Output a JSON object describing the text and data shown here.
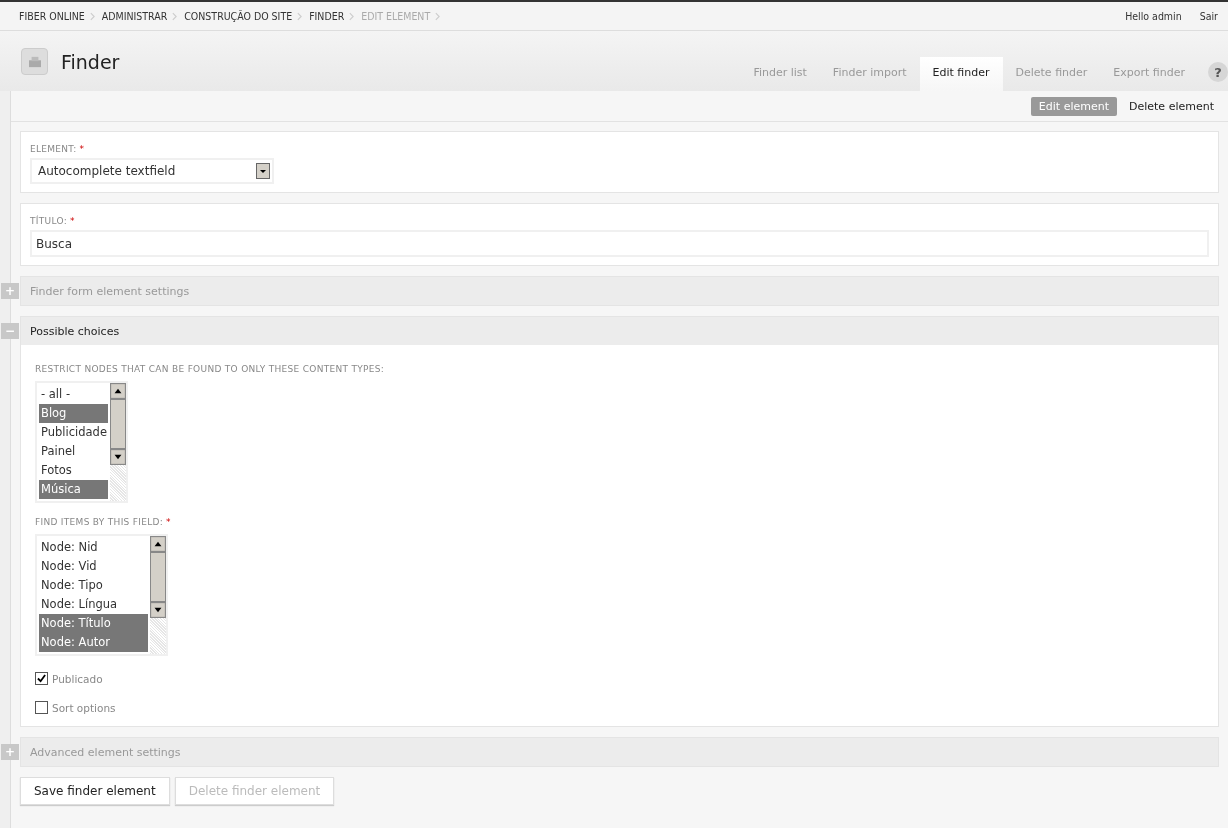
{
  "breadcrumb": [
    {
      "label": "FIBER ONLINE",
      "current": false
    },
    {
      "label": "ADMINISTRAR",
      "current": false
    },
    {
      "label": "CONSTRUÇÃO DO SITE",
      "current": false
    },
    {
      "label": "FINDER",
      "current": false
    },
    {
      "label": "EDIT ELEMENT",
      "current": true
    }
  ],
  "user_links": [
    "Hello admin",
    "Sair"
  ],
  "page_title": "Finder",
  "tabs": [
    {
      "label": "Finder list",
      "selected": false
    },
    {
      "label": "Finder import",
      "selected": false
    },
    {
      "label": "Edit finder",
      "selected": true
    },
    {
      "label": "Delete finder",
      "selected": false
    },
    {
      "label": "Export finder",
      "selected": false
    }
  ],
  "help": "?",
  "subtabs": [
    {
      "label": "Edit element",
      "selected": true
    },
    {
      "label": "Delete element",
      "selected": false
    }
  ],
  "element_field": {
    "label": "ELEMENT:",
    "required_mark": "*",
    "value": "Autocomplete textfield"
  },
  "title_field": {
    "label": "TÍTULO:",
    "required_mark": "*",
    "value": "Busca"
  },
  "fieldsets": [
    {
      "title": "Finder form element settings",
      "expanded": false,
      "toggle": "+"
    },
    {
      "title": "Possible choices",
      "expanded": true,
      "toggle": "−"
    }
  ],
  "content_types": {
    "label": "RESTRICT NODES THAT CAN BE FOUND TO ONLY THESE CONTENT TYPES:",
    "options": [
      {
        "label": "- all -",
        "selected": false
      },
      {
        "label": "Blog",
        "selected": true
      },
      {
        "label": "Publicidade",
        "selected": false
      },
      {
        "label": "Painel",
        "selected": false
      },
      {
        "label": "Fotos",
        "selected": false
      },
      {
        "label": "Música",
        "selected": true
      }
    ]
  },
  "find_field": {
    "label": "FIND ITEMS BY THIS FIELD:",
    "required_mark": "*",
    "options": [
      {
        "label": "Node: Nid",
        "selected": false
      },
      {
        "label": "Node: Vid",
        "selected": false
      },
      {
        "label": "Node: Tipo",
        "selected": false
      },
      {
        "label": "Node: Língua",
        "selected": false
      },
      {
        "label": "Node: Título",
        "selected": true
      },
      {
        "label": "Node: Autor",
        "selected": true
      }
    ]
  },
  "checkboxes": [
    {
      "label": "Publicado",
      "checked": true
    },
    {
      "label": "Sort options",
      "checked": false
    }
  ],
  "advanced": {
    "title": "Advanced element settings",
    "expanded": false,
    "toggle": "+"
  },
  "buttons": [
    {
      "label": "Save finder element",
      "disabled": false
    },
    {
      "label": "Delete finder element",
      "disabled": true
    }
  ]
}
